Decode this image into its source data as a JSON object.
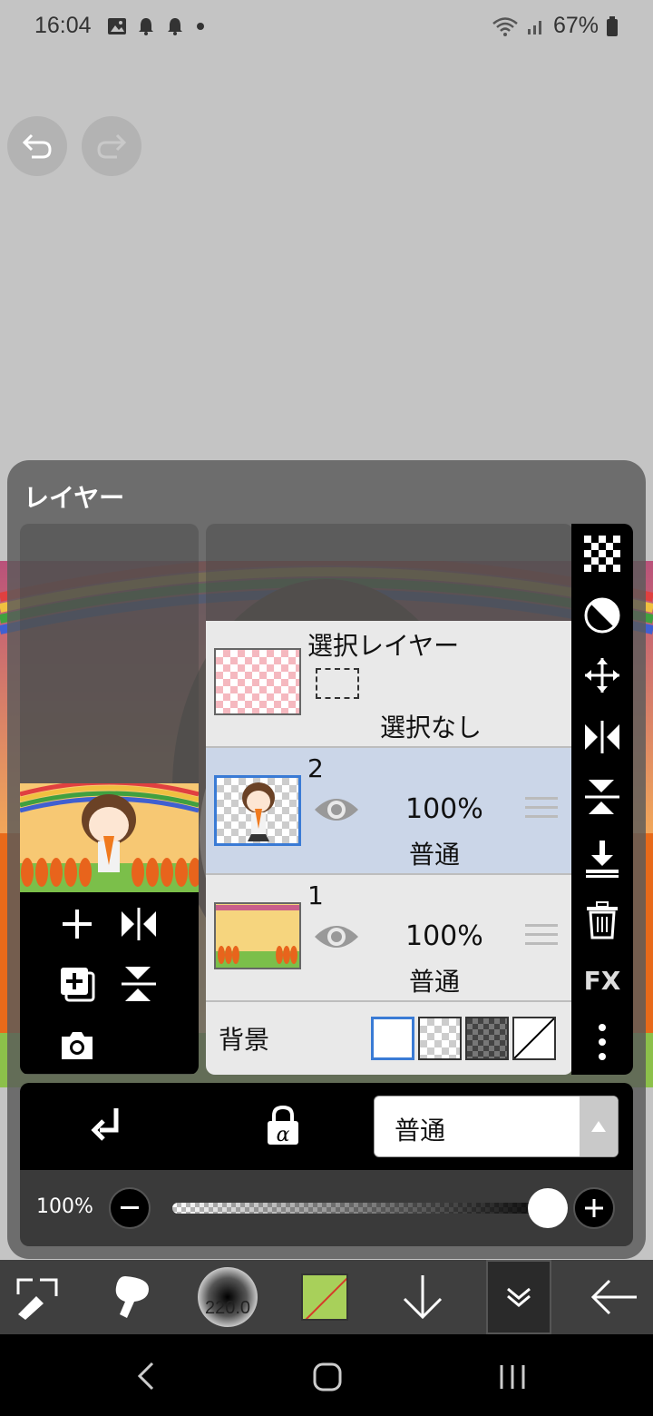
{
  "status_bar": {
    "time": "16:04",
    "battery": "67%",
    "icons": [
      "image-icon",
      "bell-icon",
      "bell-icon",
      "dot-icon",
      "wifi-icon",
      "signal-icon",
      "battery-icon"
    ]
  },
  "canvas": {
    "undo_icon": "undo-icon",
    "redo_icon": "redo-icon"
  },
  "layer_panel": {
    "title": "レイヤー",
    "selection_layer": {
      "name": "選択レイヤー",
      "status": "選択なし"
    },
    "layers": [
      {
        "number": "2",
        "opacity": "100%",
        "blend": "普通",
        "selected": true
      },
      {
        "number": "1",
        "opacity": "100%",
        "blend": "普通",
        "selected": false
      }
    ],
    "background": {
      "label": "背景",
      "options": [
        "white",
        "transparent",
        "dark-checker",
        "none"
      ]
    },
    "left_tools": [
      "add-layer-icon",
      "flip-horizontal-icon",
      "duplicate-layer-icon",
      "flip-vertical-icon",
      "camera-icon"
    ],
    "right_tools": [
      "checker-icon",
      "mask-icon",
      "move-icon",
      "flip-horizontal-icon",
      "flip-vertical-icon",
      "merge-down-icon",
      "trash-icon",
      "fx-label",
      "more-icon"
    ],
    "fx_label": "FX",
    "blend_mode": "普通",
    "opacity_label": "100%",
    "opacity_value": 1.0
  },
  "bottom_toolbar": {
    "brush_size": "220.0",
    "colors": {
      "accent": "#a8d05a",
      "panel": "#5a5a5a"
    }
  }
}
